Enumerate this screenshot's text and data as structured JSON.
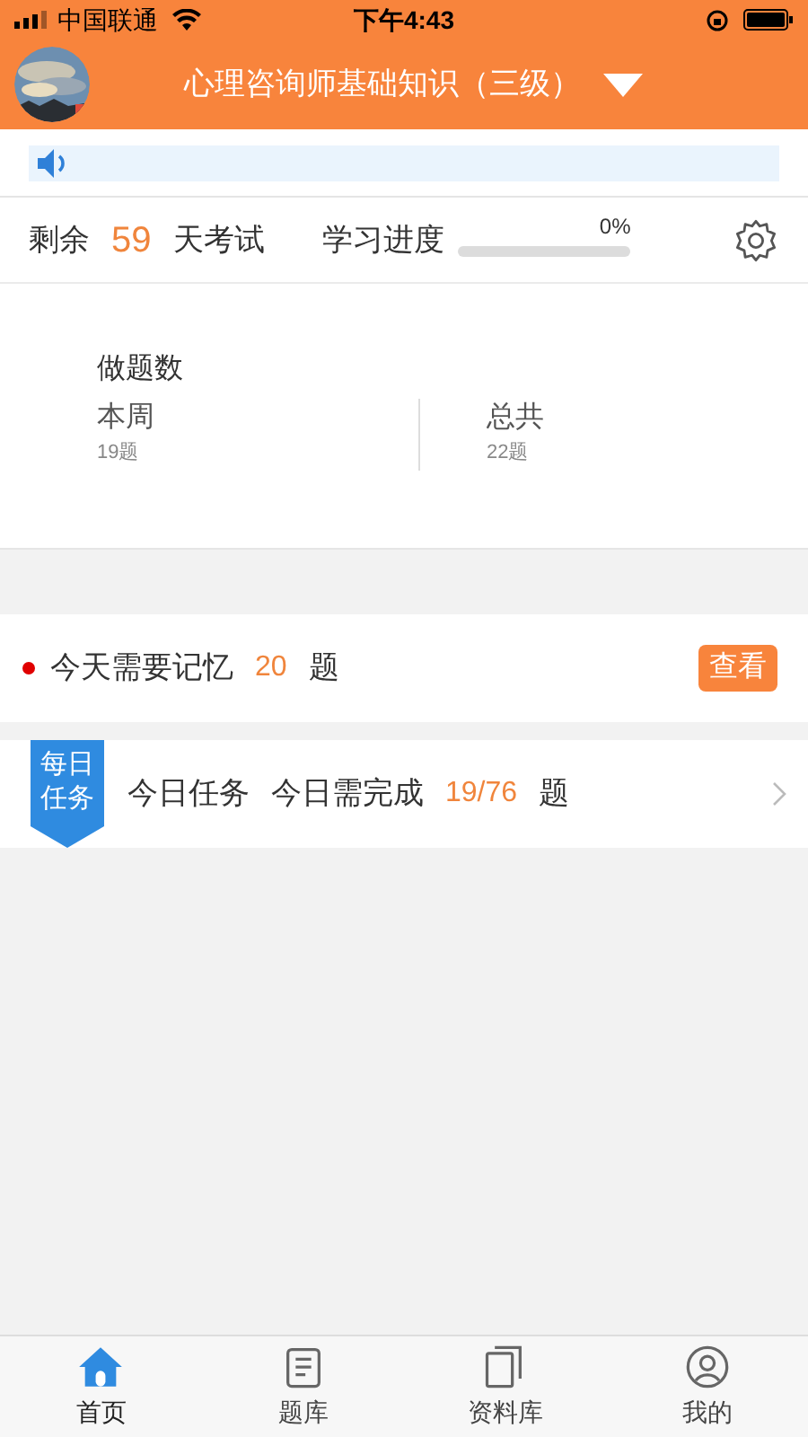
{
  "status_bar": {
    "carrier": "中国联通",
    "time": "下午4:43"
  },
  "header": {
    "title": "心理咨询师基础知识（三级）"
  },
  "summary": {
    "prefix": "剩余",
    "days": "59",
    "suffix": "天考试",
    "progress_label": "学习进度",
    "progress_text": "0%",
    "level": 0
  },
  "stats": {
    "title": "做题数",
    "items": [
      {
        "label": "本周",
        "value": "19题"
      },
      {
        "label": "总共",
        "value": "22题"
      }
    ]
  },
  "memory": {
    "text": "今天需要记忆",
    "count": "20",
    "unit": "题",
    "button": "查看"
  },
  "task": {
    "badge": "每日任务",
    "title": "今日任务",
    "text": "今日需完成",
    "count": "19/76",
    "unit": "题"
  },
  "tabs": [
    {
      "label": "首页",
      "selected": true
    },
    {
      "label": "题库",
      "selected": false
    },
    {
      "label": "资料库",
      "selected": false
    },
    {
      "label": "我的",
      "selected": false
    }
  ]
}
